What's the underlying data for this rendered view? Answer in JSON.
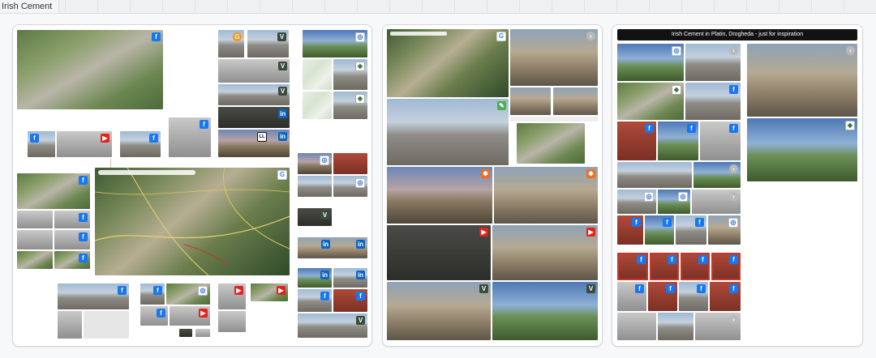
{
  "board": {
    "title": "Irish Cement"
  },
  "frames": {
    "frame2": {
      "title": "Irish Cement in Platin, Drogheda - just for inspiration"
    }
  },
  "icons": {
    "facebook": "f",
    "google": "G",
    "youtube": "▶",
    "linkedin": "in",
    "vimeo": "V",
    "instagram": "◎",
    "fire": "🔥",
    "external": "›",
    "leaf": "✎",
    "goo": "G",
    "shield": "◈",
    "lineup": "LL"
  },
  "colors": {
    "selection": "#c0392b",
    "facebook": "#1877f2",
    "youtube": "#e62117",
    "linkedin": "#0a66c2"
  }
}
